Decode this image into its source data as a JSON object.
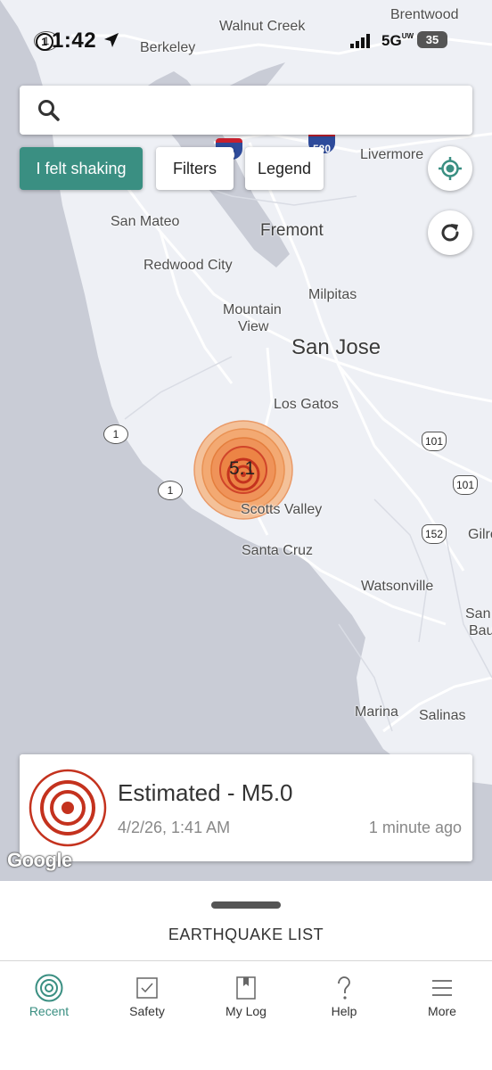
{
  "status_bar": {
    "time": "1:42",
    "route_badge": "1",
    "network": "5G",
    "network_sub": "UW",
    "battery": "35"
  },
  "search": {
    "placeholder": ""
  },
  "filters": {
    "felt_label": "I felt shaking",
    "filters_label": "Filters",
    "legend_label": "Legend"
  },
  "map": {
    "places": [
      {
        "name": "Walnut Creek",
        "size": "small"
      },
      {
        "name": "Brentwood",
        "size": "small"
      },
      {
        "name": "Berkeley",
        "size": "small"
      },
      {
        "name": "Livermore",
        "size": "small"
      },
      {
        "name": "San Mateo",
        "size": "small"
      },
      {
        "name": "Fremont",
        "size": "mid"
      },
      {
        "name": "Redwood City",
        "size": "small"
      },
      {
        "name": "Milpitas",
        "size": "small"
      },
      {
        "name": "Mountain",
        "size": "small"
      },
      {
        "name": "View",
        "size": "small"
      },
      {
        "name": "San Jose",
        "size": "big"
      },
      {
        "name": "Los Gatos",
        "size": "small"
      },
      {
        "name": "Scotts Valley",
        "size": "small"
      },
      {
        "name": "Santa Cruz",
        "size": "small"
      },
      {
        "name": "Watsonville",
        "size": "small"
      },
      {
        "name": "San",
        "size": "small"
      },
      {
        "name": "Bau",
        "size": "small"
      },
      {
        "name": "Gilro",
        "size": "small"
      },
      {
        "name": "Marina",
        "size": "small"
      },
      {
        "name": "Salinas",
        "size": "small"
      }
    ],
    "shields": [
      "1",
      "1",
      "1",
      "101",
      "101",
      "152",
      "580",
      "80"
    ],
    "quake_magnitude_label": "5.1",
    "attribution": "Google"
  },
  "event_card": {
    "title": "Estimated - M5.0",
    "date": "4/2/26, 1:41 AM",
    "ago": "1 minute ago"
  },
  "sheet": {
    "label": "EARTHQUAKE LIST"
  },
  "tabs": [
    {
      "label": "Recent",
      "icon": "target-icon",
      "active": true
    },
    {
      "label": "Safety",
      "icon": "checkbox-icon",
      "active": false
    },
    {
      "label": "My Log",
      "icon": "bookmark-icon",
      "active": false
    },
    {
      "label": "Help",
      "icon": "question-icon",
      "active": false
    },
    {
      "label": "More",
      "icon": "menu-icon",
      "active": false
    }
  ],
  "colors": {
    "accent": "#3a8f82",
    "water": "#c9ccd6",
    "land": "#eef0f5",
    "quake_orange": "#f0a060",
    "quake_red": "#d03a20"
  }
}
